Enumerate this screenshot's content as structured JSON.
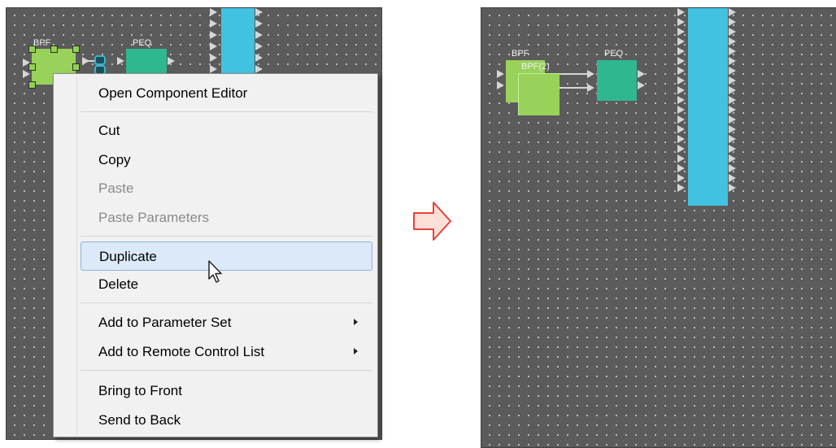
{
  "left_panel": {
    "blocks": {
      "bpf_label": "BPF",
      "peq_label": "PEQ"
    },
    "context_menu": {
      "items": [
        {
          "label": "Open Component Editor",
          "enabled": true
        },
        {
          "label": "Cut",
          "enabled": true
        },
        {
          "label": "Copy",
          "enabled": true
        },
        {
          "label": "Paste",
          "enabled": false
        },
        {
          "label": "Paste Parameters",
          "enabled": false
        },
        {
          "label": "Duplicate",
          "enabled": true,
          "hovered": true
        },
        {
          "label": "Delete",
          "enabled": true
        },
        {
          "label": "Add to Parameter Set",
          "enabled": true,
          "submenu": true
        },
        {
          "label": "Add to Remote Control List",
          "enabled": true,
          "submenu": true
        },
        {
          "label": "Bring to Front",
          "enabled": true
        },
        {
          "label": "Send to Back",
          "enabled": true
        }
      ]
    }
  },
  "transition_arrow": {
    "icon": "right-arrow-icon",
    "color": "#e8413a",
    "fill": "#fde1d8"
  },
  "right_panel": {
    "blocks": {
      "bpf_label": "BPF",
      "bpf_copy_label": "BPF(2)",
      "peq_label": "PEQ"
    }
  },
  "colors": {
    "canvas": "#5b5b5b",
    "bpf": "#98d25a",
    "peq": "#2fb78f",
    "bus": "#41c2e0",
    "menu_hover": "#dbe9f8"
  }
}
